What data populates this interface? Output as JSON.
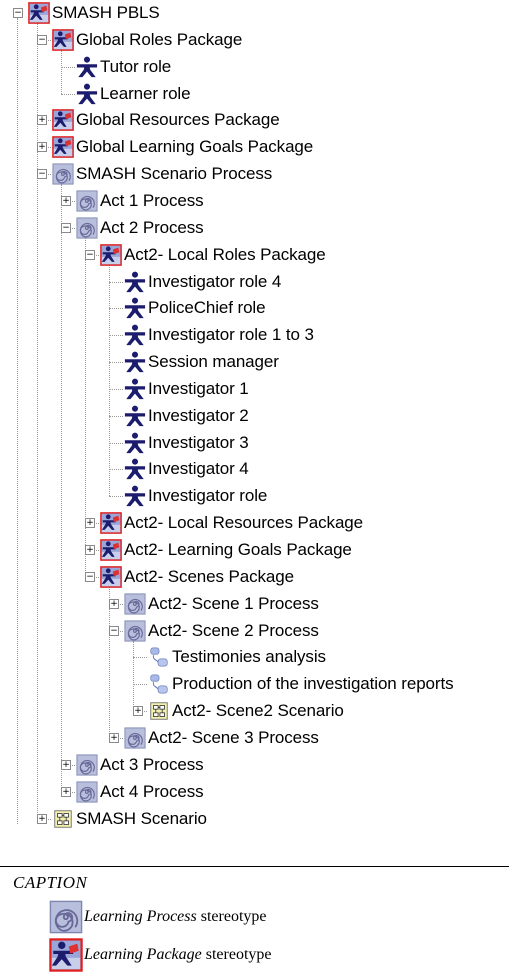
{
  "tree": {
    "nodes": [
      {
        "label": "SMASH PBLS",
        "depth": 0,
        "icon": "package",
        "toggle": "-"
      },
      {
        "label": "Global Roles Package",
        "depth": 1,
        "icon": "package",
        "toggle": "-"
      },
      {
        "label": "Tutor role",
        "depth": 2,
        "icon": "role",
        "toggle": ""
      },
      {
        "label": "Learner role",
        "depth": 2,
        "icon": "role",
        "toggle": ""
      },
      {
        "label": "Global Resources Package",
        "depth": 1,
        "icon": "package",
        "toggle": "+"
      },
      {
        "label": "Global Learning Goals Package",
        "depth": 1,
        "icon": "package",
        "toggle": "+"
      },
      {
        "label": "SMASH Scenario Process",
        "depth": 1,
        "icon": "process",
        "toggle": "-"
      },
      {
        "label": "Act 1 Process",
        "depth": 2,
        "icon": "process",
        "toggle": "+"
      },
      {
        "label": "Act 2 Process",
        "depth": 2,
        "icon": "process",
        "toggle": "-"
      },
      {
        "label": "Act2- Local Roles Package",
        "depth": 3,
        "icon": "package",
        "toggle": "-"
      },
      {
        "label": "Investigator role 4",
        "depth": 4,
        "icon": "role",
        "toggle": ""
      },
      {
        "label": "PoliceChief role",
        "depth": 4,
        "icon": "role",
        "toggle": ""
      },
      {
        "label": "Investigator role 1 to 3",
        "depth": 4,
        "icon": "role",
        "toggle": ""
      },
      {
        "label": "Session manager",
        "depth": 4,
        "icon": "role",
        "toggle": ""
      },
      {
        "label": "Investigator 1",
        "depth": 4,
        "icon": "role",
        "toggle": ""
      },
      {
        "label": "Investigator 2",
        "depth": 4,
        "icon": "role",
        "toggle": ""
      },
      {
        "label": "Investigator 3",
        "depth": 4,
        "icon": "role",
        "toggle": ""
      },
      {
        "label": "Investigator 4",
        "depth": 4,
        "icon": "role",
        "toggle": ""
      },
      {
        "label": "Investigator role",
        "depth": 4,
        "icon": "role",
        "toggle": ""
      },
      {
        "label": "Act2- Local Resources Package",
        "depth": 3,
        "icon": "package",
        "toggle": "+"
      },
      {
        "label": "Act2- Learning Goals Package",
        "depth": 3,
        "icon": "package",
        "toggle": "+"
      },
      {
        "label": "Act2- Scenes Package",
        "depth": 3,
        "icon": "package",
        "toggle": "-"
      },
      {
        "label": "Act2- Scene 1 Process",
        "depth": 4,
        "icon": "process",
        "toggle": "+"
      },
      {
        "label": "Act2- Scene 2 Process",
        "depth": 4,
        "icon": "process",
        "toggle": "-"
      },
      {
        "label": "Testimonies analysis",
        "depth": 5,
        "icon": "activity",
        "toggle": ""
      },
      {
        "label": "Production of the investigation reports",
        "depth": 5,
        "icon": "activity",
        "toggle": ""
      },
      {
        "label": "Act2- Scene2 Scenario",
        "depth": 5,
        "icon": "scenario",
        "toggle": "+"
      },
      {
        "label": "Act2- Scene 3 Process",
        "depth": 4,
        "icon": "process",
        "toggle": "+"
      },
      {
        "label": "Act 3 Process",
        "depth": 2,
        "icon": "process",
        "toggle": "+"
      },
      {
        "label": "Act 4 Process",
        "depth": 2,
        "icon": "process",
        "toggle": "+"
      },
      {
        "label": "SMASH Scenario",
        "depth": 1,
        "icon": "scenario",
        "toggle": "+"
      }
    ]
  },
  "caption": {
    "title": "CAPTION",
    "process_emph": "Learning Process",
    "process_rest": "stereotype",
    "package_emph": "Learning Package",
    "package_rest": "stereotype"
  },
  "colors": {
    "role": "#1c1c6e",
    "package_border": "#e02020",
    "spiral": "#6a6a9a",
    "process_bg": "#b8bfdc"
  }
}
